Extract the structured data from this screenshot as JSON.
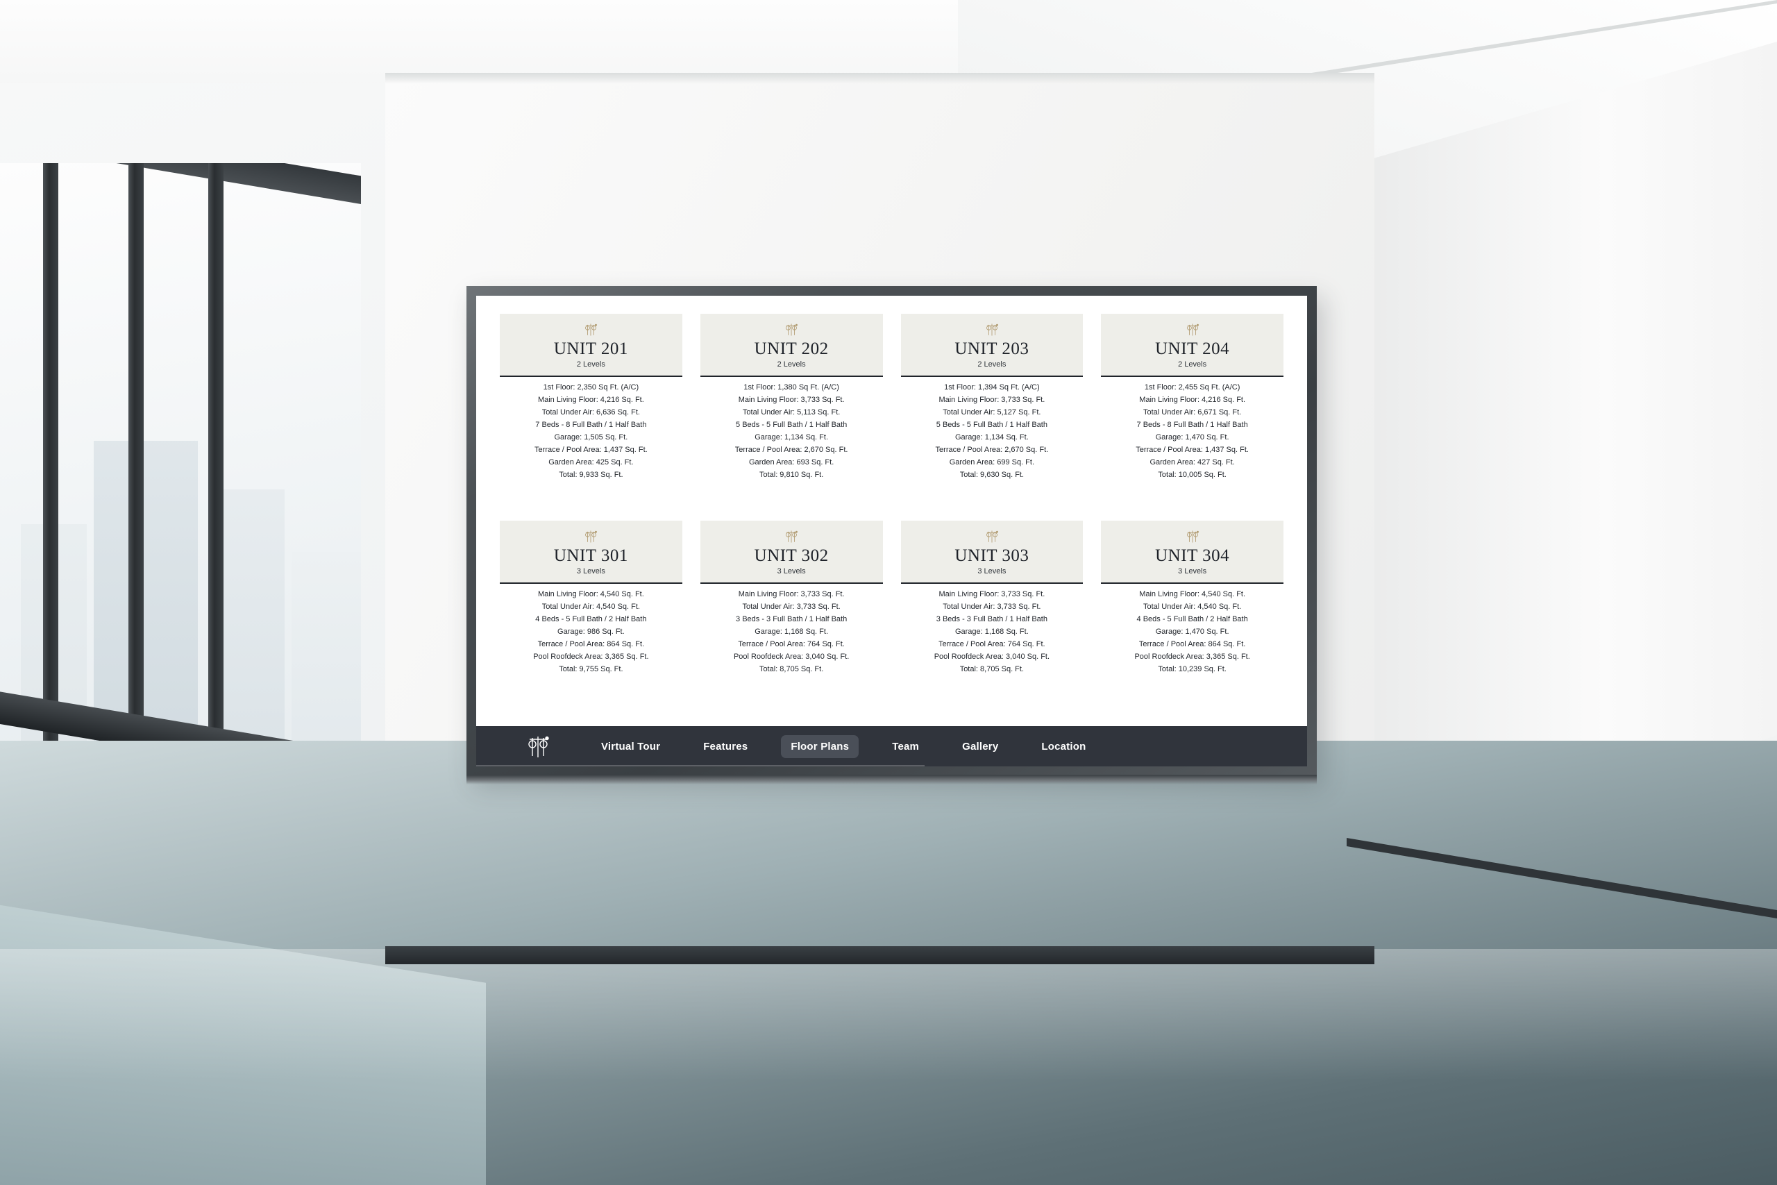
{
  "scene": {
    "environment_name": "empty-modern-room-with-framed-display",
    "wall_color": "#f3f3f2",
    "floor_color": "#6f8187",
    "frame_color": "#43484c"
  },
  "screen": {
    "background": "#ffffff",
    "page_name": "Floor Plans"
  },
  "brand": {
    "mark_name": "monogram-logo",
    "mark_color_card": "#b09a6f",
    "mark_color_nav": "#ffffff"
  },
  "card_style": {
    "header_bg": "#eeeee9",
    "rule_color": "#20242a",
    "text_color": "#23272d"
  },
  "units": [
    {
      "title": "UNIT 201",
      "levels": "2 Levels",
      "specs": [
        "1st Floor: 2,350 Sq Ft. (A/C)",
        "Main Living Floor: 4,216 Sq. Ft.",
        "Total Under Air: 6,636 Sq. Ft.",
        "7 Beds - 8 Full Bath / 1 Half Bath",
        "Garage: 1,505 Sq. Ft.",
        "Terrace / Pool Area: 1,437 Sq. Ft.",
        "Garden Area: 425 Sq. Ft.",
        "Total: 9,933 Sq. Ft."
      ]
    },
    {
      "title": "UNIT 202",
      "levels": "2 Levels",
      "specs": [
        "1st Floor: 1,380 Sq Ft. (A/C)",
        "Main Living Floor: 3,733 Sq. Ft.",
        "Total Under Air: 5,113 Sq. Ft.",
        "5 Beds - 5 Full Bath / 1 Half Bath",
        "Garage: 1,134 Sq. Ft.",
        "Terrace / Pool Area: 2,670 Sq. Ft.",
        "Garden Area: 693 Sq. Ft.",
        "Total: 9,810 Sq. Ft."
      ]
    },
    {
      "title": "UNIT 203",
      "levels": "2 Levels",
      "specs": [
        "1st Floor: 1,394 Sq Ft. (A/C)",
        "Main Living Floor: 3,733 Sq. Ft.",
        "Total Under Air: 5,127 Sq. Ft.",
        "5 Beds - 5 Full Bath / 1 Half Bath",
        "Garage: 1,134 Sq. Ft.",
        "Terrace / Pool Area: 2,670 Sq. Ft.",
        "Garden Area: 699 Sq. Ft.",
        "Total: 9,630 Sq. Ft."
      ]
    },
    {
      "title": "UNIT 204",
      "levels": "2 Levels",
      "specs": [
        "1st Floor: 2,455 Sq Ft. (A/C)",
        "Main Living Floor: 4,216 Sq. Ft.",
        "Total Under Air: 6,671 Sq. Ft.",
        "7 Beds - 8 Full Bath / 1 Half Bath",
        "Garage: 1,470 Sq. Ft.",
        "Terrace / Pool Area: 1,437 Sq. Ft.",
        "Garden Area: 427 Sq. Ft.",
        "Total: 10,005 Sq. Ft."
      ]
    },
    {
      "title": "UNIT 301",
      "levels": "3 Levels",
      "specs": [
        "Main Living Floor: 4,540 Sq. Ft.",
        "Total Under Air: 4,540 Sq. Ft.",
        "4 Beds - 5 Full Bath / 2 Half Bath",
        "Garage: 986 Sq. Ft.",
        "Terrace / Pool Area: 864 Sq. Ft.",
        "Pool Roofdeck Area: 3,365 Sq. Ft.",
        "Total: 9,755 Sq. Ft."
      ]
    },
    {
      "title": "UNIT 302",
      "levels": "3 Levels",
      "specs": [
        "Main Living Floor: 3,733 Sq. Ft.",
        "Total Under Air: 3,733 Sq. Ft.",
        "3 Beds - 3 Full Bath / 1 Half Bath",
        "Garage: 1,168 Sq. Ft.",
        "Terrace / Pool Area: 764 Sq. Ft.",
        "Pool Roofdeck Area: 3,040 Sq. Ft.",
        "Total: 8,705 Sq. Ft."
      ]
    },
    {
      "title": "UNIT 303",
      "levels": "3 Levels",
      "specs": [
        "Main Living Floor: 3,733 Sq. Ft.",
        "Total Under Air: 3,733 Sq. Ft.",
        "3 Beds - 3 Full Bath / 1 Half Bath",
        "Garage: 1,168 Sq. Ft.",
        "Terrace / Pool Area: 764 Sq. Ft.",
        "Pool Roofdeck Area: 3,040 Sq. Ft.",
        "Total: 8,705 Sq. Ft."
      ]
    },
    {
      "title": "UNIT 304",
      "levels": "3 Levels",
      "specs": [
        "Main Living Floor: 4,540 Sq. Ft.",
        "Total Under Air: 4,540 Sq. Ft.",
        "4 Beds - 5 Full Bath / 2 Half Bath",
        "Garage: 1,470 Sq. Ft.",
        "Terrace / Pool Area: 864 Sq. Ft.",
        "Pool Roofdeck Area: 3,365 Sq. Ft.",
        "Total: 10,239 Sq. Ft."
      ]
    }
  ],
  "nav": {
    "background": "#30343c",
    "active_background": "#4a4f58",
    "active_item": "Floor Plans",
    "items": [
      {
        "label": "Virtual Tour",
        "active": false
      },
      {
        "label": "Features",
        "active": false
      },
      {
        "label": "Floor Plans",
        "active": true
      },
      {
        "label": "Team",
        "active": false
      },
      {
        "label": "Gallery",
        "active": false
      },
      {
        "label": "Location",
        "active": false
      }
    ]
  }
}
